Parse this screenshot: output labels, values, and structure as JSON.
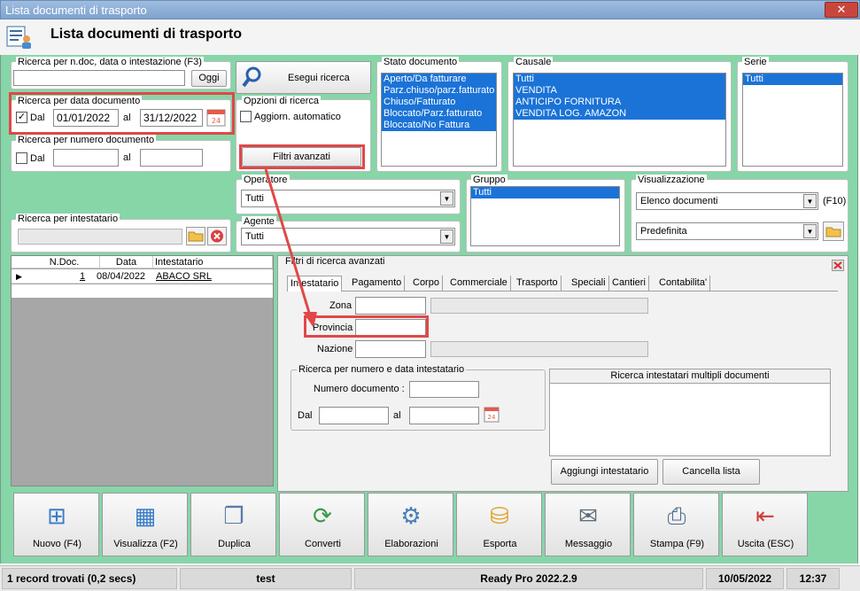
{
  "window": {
    "title": "Lista documenti di trasporto",
    "close": "✕"
  },
  "header": {
    "title": "Lista documenti di trasporto"
  },
  "ricerca_ndoc": {
    "label": "Ricerca per n.doc, data o intestazione (F3)",
    "value": "",
    "oggi": "Oggi"
  },
  "esegui": {
    "label": "Esegui ricerca"
  },
  "data_doc": {
    "label": "Ricerca per data documento",
    "dal": "Dal",
    "dal_value": "01/01/2022",
    "al": "al",
    "al_value": "31/12/2022",
    "checked": "✓"
  },
  "opzioni": {
    "label": "Opzioni di ricerca",
    "aggiorn": "Aggiorn. automatico"
  },
  "filtri_btn": {
    "label": "Filtri avanzati"
  },
  "numero_doc": {
    "label": "Ricerca per numero documento",
    "dal": "Dal",
    "al": "al"
  },
  "stato": {
    "label": "Stato documento",
    "items": [
      "Aperto/Da fatturare",
      "Parz.chiuso/parz.fatturato",
      "Chiuso/Fatturato",
      "Bloccato/Parz.fatturato",
      "Bloccato/No Fattura"
    ]
  },
  "causale": {
    "label": "Causale",
    "items": [
      "Tutti",
      "VENDITA",
      "ANTICIPO FORNITURA",
      "VENDITA LOG. AMAZON"
    ]
  },
  "serie": {
    "label": "Serie",
    "items": [
      "Tutti"
    ]
  },
  "operatore": {
    "label": "Operatore",
    "value": "Tutti"
  },
  "gruppo": {
    "label": "Gruppo",
    "items": [
      "Tutti"
    ]
  },
  "visualizzazione": {
    "label": "Visualizzazione",
    "value": "Elenco documenti",
    "shortcut": "(F10)",
    "value2": "Predefinita"
  },
  "intestatario": {
    "label": "Ricerca per intestatario"
  },
  "agente": {
    "label": "Agente",
    "value": "Tutti"
  },
  "grid": {
    "columns": [
      "N.Doc.",
      "Data",
      "Intestatario"
    ],
    "rows": [
      {
        "ndoc": "1",
        "data": "08/04/2022",
        "intestatario": "ABACO SRL"
      }
    ]
  },
  "adv": {
    "title": "Filtri di ricerca avanzati",
    "tabs": [
      "Intestatario",
      "Pagamento",
      "Corpo",
      "Commerciale",
      "Trasporto",
      "Speciali",
      "Cantieri",
      "Contabilita'"
    ],
    "zona": "Zona",
    "provincia": "Provincia",
    "nazione": "Nazione",
    "numdata_label": "Ricerca per numero e data intestatario",
    "numero_doc": "Numero documento :",
    "dal": "Dal",
    "al": "al",
    "multipli": "Ricerca intestatari multipli documenti",
    "aggiungi": "Aggiungi intestatario",
    "cancella": "Cancella lista"
  },
  "toolbar": [
    {
      "label": "Nuovo (F4)",
      "icon": "new-icon"
    },
    {
      "label": "Visualizza (F2)",
      "icon": "view-icon"
    },
    {
      "label": "Duplica",
      "icon": "duplicate-icon"
    },
    {
      "label": "Converti",
      "icon": "convert-icon"
    },
    {
      "label": "Elaborazioni",
      "icon": "process-icon"
    },
    {
      "label": "Esporta",
      "icon": "export-icon"
    },
    {
      "label": "Messaggio",
      "icon": "message-icon"
    },
    {
      "label": "Stampa (F9)",
      "icon": "print-icon"
    },
    {
      "label": "Uscita (ESC)",
      "icon": "exit-icon"
    }
  ],
  "status": {
    "records": "1 record trovati (0,2 secs)",
    "user": "test",
    "app": "Ready Pro 2022.2.9",
    "date": "10/05/2022",
    "time": "12:37"
  },
  "colors": {
    "selection": "#1b73d7",
    "panel": "#86d6a8",
    "highlight": "#e04848"
  }
}
